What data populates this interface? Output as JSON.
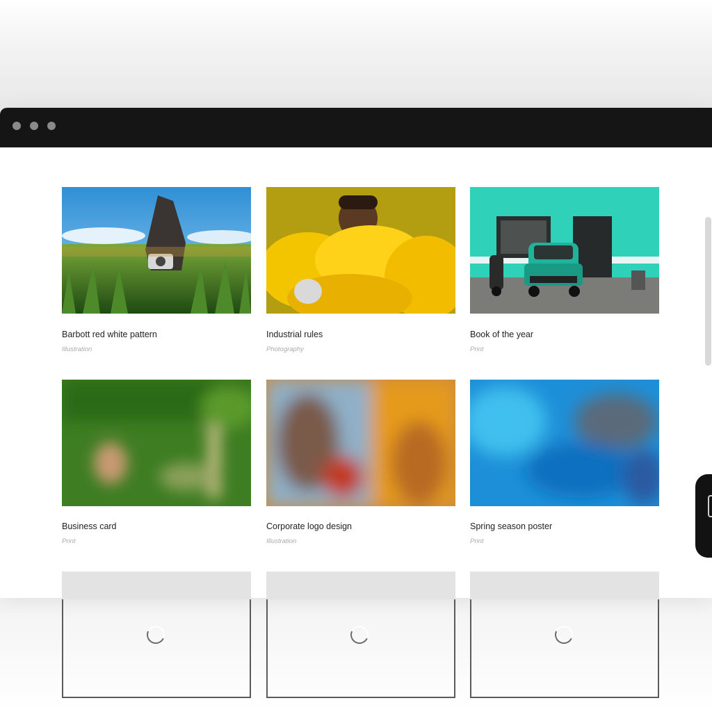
{
  "portfolio": {
    "items": [
      {
        "title": "Barbott red white pattern",
        "category": "Illustration"
      },
      {
        "title": "Industrial rules",
        "category": "Photography"
      },
      {
        "title": "Book of the year",
        "category": "Print"
      },
      {
        "title": "Business card",
        "category": "Print"
      },
      {
        "title": "Corporate logo design",
        "category": "Illustration"
      },
      {
        "title": "Spring season poster",
        "category": "Print"
      }
    ],
    "loading_placeholders": 3
  },
  "colors": {
    "titlebar": "#151515",
    "window_dots": "#8a8a8a",
    "text": "#222222",
    "category_text": "#aaaaaa",
    "floating_button": "#121212"
  },
  "icons": {
    "window_controls": "three-dots",
    "loading": "spinner-icon",
    "floating_button": "panel-icon"
  }
}
